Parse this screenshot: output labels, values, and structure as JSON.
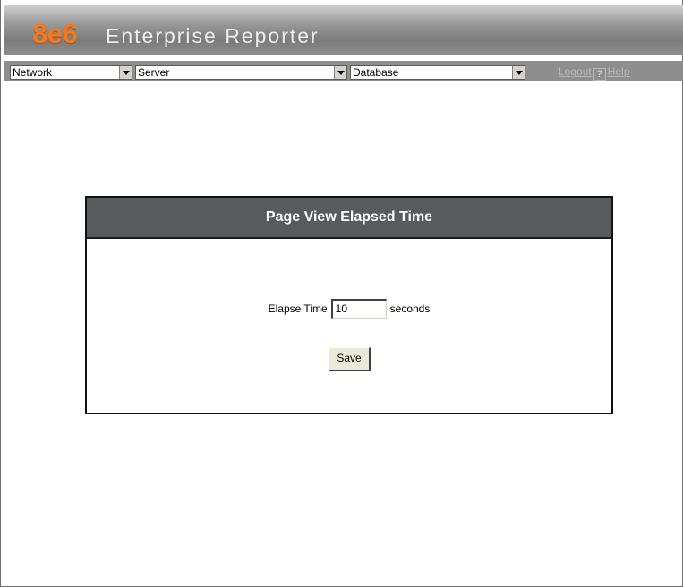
{
  "header": {
    "logo_number": "8e6",
    "logo_text": "Enterprise Reporter"
  },
  "nav": {
    "selects": [
      {
        "value": "Network"
      },
      {
        "value": "Server"
      },
      {
        "value": "Database"
      }
    ],
    "logout": "Logout",
    "help_symbol": "?",
    "help": "Help"
  },
  "panel": {
    "title": "Page View Elapsed Time",
    "elapse_label": "Elapse Time",
    "elapse_value": "10",
    "seconds_label": "seconds",
    "save_label": "Save"
  },
  "colors": {
    "logo_orange": "#f07a22",
    "panel_header": "#585b5e",
    "nav_bar": "#8e8e8e"
  }
}
